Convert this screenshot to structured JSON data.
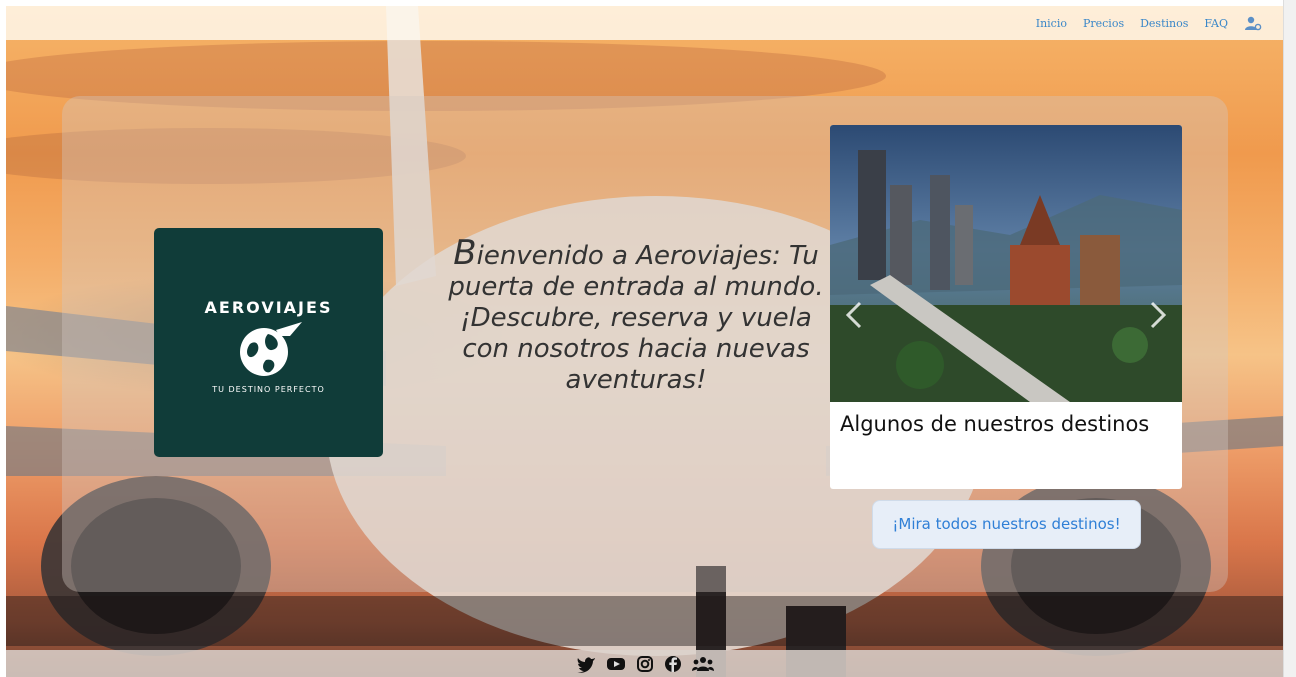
{
  "nav": {
    "items": [
      {
        "label": "Inicio"
      },
      {
        "label": "Precios"
      },
      {
        "label": "Destinos"
      },
      {
        "label": "FAQ"
      }
    ],
    "user_icon": "user-settings-icon",
    "link_color": "#3a87c8"
  },
  "logo": {
    "brand": "AEROVIAJES",
    "tagline": "TU DESTINO PERFECTO",
    "bg_color": "#103c39"
  },
  "hero": {
    "initial": "B",
    "welcome_rest": "ienvenido a Aeroviajes: Tu puerta de entrada al mundo. ¡Descubre, reserva y vuela con nosotros hacia nuevas aventuras!"
  },
  "destinations": {
    "title": "Algunos de nuestros destinos",
    "prev_icon": "chevron-left-icon",
    "next_icon": "chevron-right-icon"
  },
  "cta": {
    "label": "¡Mira todos nuestros destinos!"
  },
  "footer": {
    "icons": [
      "twitter-icon",
      "youtube-icon",
      "instagram-icon",
      "facebook-icon",
      "community-icon"
    ]
  }
}
